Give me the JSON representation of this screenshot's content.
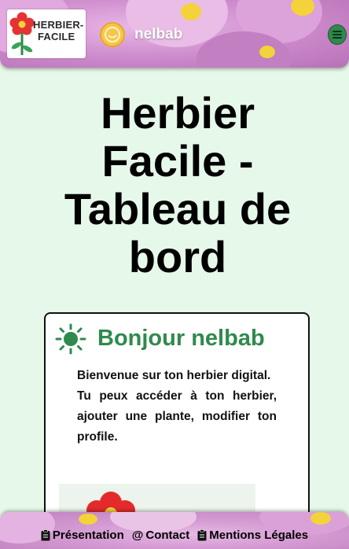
{
  "header": {
    "logo": {
      "text_line1": "HERBIER-",
      "text_line2": "FACILE"
    },
    "username": "nelbab",
    "menu_icon": "hamburger-icon"
  },
  "main": {
    "title_lines": [
      "Herbier",
      "Facile -",
      "Tableau de",
      "bord"
    ]
  },
  "card": {
    "icon": "sun-icon",
    "title": "Bonjour nelbab",
    "paragraph1": "Bienvenue sur ton herbier digital.",
    "paragraph2": "Tu peux accéder à ton herbier, ajouter une plante, modifier ton profile."
  },
  "footer": {
    "links": [
      {
        "label": "Présentation",
        "icon": "clipboard-icon"
      },
      {
        "label": "Contact",
        "icon": "at-icon"
      },
      {
        "label": "Mentions Légales",
        "icon": "clipboard-icon"
      }
    ]
  },
  "colors": {
    "background": "#e6f8e9",
    "accent_green": "#2f8a4d",
    "sun_green": "#2f8a4d",
    "flower_pink": "#d79ad6",
    "flower_yellow": "#f4d23a"
  }
}
